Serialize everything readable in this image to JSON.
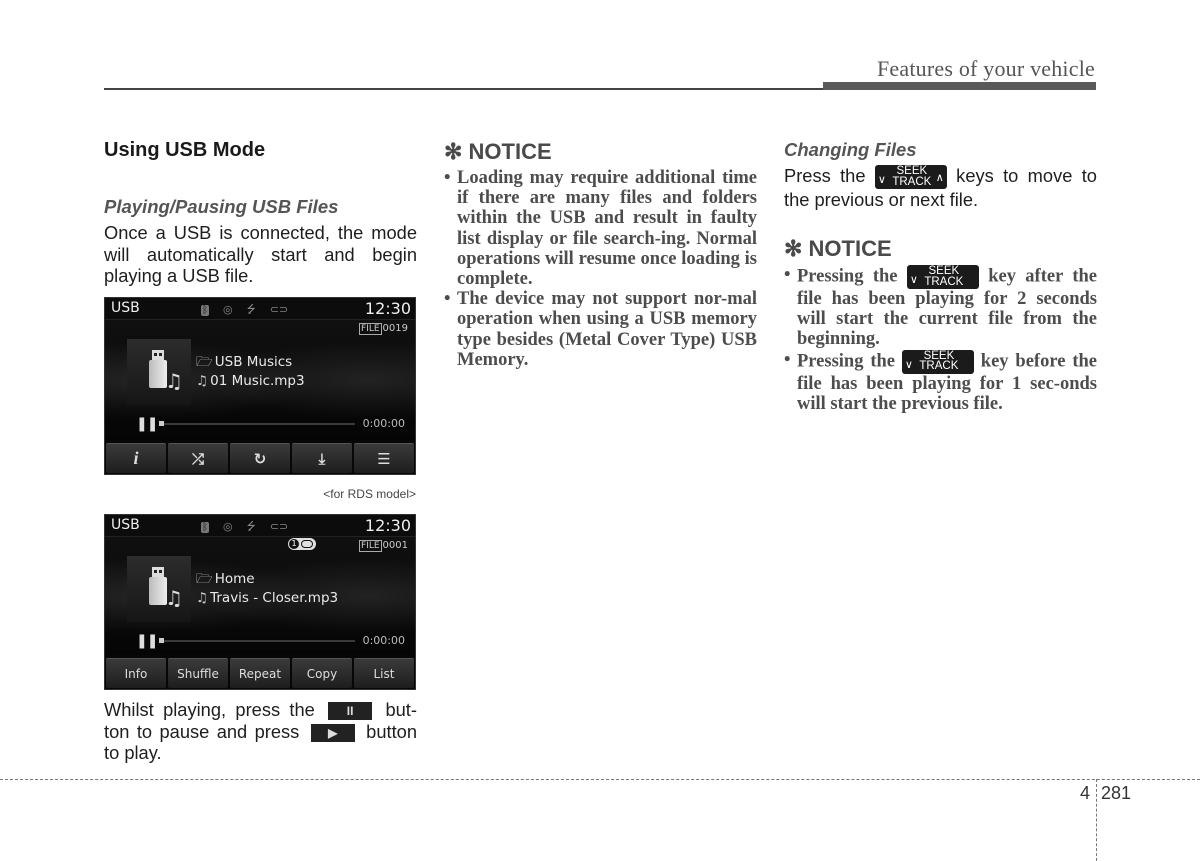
{
  "header": {
    "section_title": "Features of your vehicle"
  },
  "column1": {
    "title": "Using USB Mode",
    "subhead": "Playing/Pausing USB Files",
    "intro": "Once a USB is connected, the mode will automatically start and begin playing a USB file.",
    "caption": "<for RDS model>",
    "play_text": {
      "part1": "Whilst playing, press the",
      "part2": "but-ton to pause and press",
      "part3": "button to play.",
      "pause_glyph": "II",
      "play_glyph": "▶"
    }
  },
  "screen1": {
    "mode": "USB",
    "clock": "12:30",
    "status_icons": [
      "bluetooth-icon",
      "disc-icon",
      "usb-icon",
      "aux-icon"
    ],
    "file_tag": "FILE",
    "file_number": "0019",
    "folder": "USB Musics",
    "track": "01 Music.mp3",
    "elapsed": "0:00:00",
    "progress": 0,
    "softkeys": [
      {
        "icon": "info-icon",
        "glyph": "i"
      },
      {
        "icon": "shuffle-icon",
        "glyph": "⤮"
      },
      {
        "icon": "repeat-icon",
        "glyph": "↻"
      },
      {
        "icon": "copy-icon",
        "glyph": "⤓"
      },
      {
        "icon": "list-icon",
        "glyph": "☰"
      }
    ]
  },
  "screen2": {
    "mode": "USB",
    "clock": "12:30",
    "repeat_badge": "1",
    "file_tag": "FILE",
    "file_number": "0001",
    "folder": "Home",
    "track": "Travis - Closer.mp3",
    "elapsed": "0:00:00",
    "progress": 0,
    "softkeys": [
      "Info",
      "Shuffle",
      "Repeat",
      "Copy",
      "List"
    ]
  },
  "column2": {
    "notice_title": "✻ NOTICE",
    "items": [
      "Loading may require additional time if there are many files and folders within the USB and result in faulty list display or file search-ing. Normal operations will resume once loading is complete.",
      "The device may not support nor-mal operation when using a USB memory type besides (Metal Cover Type) USB Memory."
    ]
  },
  "column3": {
    "subhead": "Changing Files",
    "change_text": {
      "before": "Press the",
      "after": "keys to move to the previous or next file."
    },
    "seek_key": {
      "top": "SEEK",
      "bottom": "TRACK",
      "down": "∨",
      "up": "∧"
    },
    "notice_title": "✻ NOTICE",
    "items": [
      {
        "before": "Pressing the",
        "after": "key after the file has been playing for 2 seconds will start the current file from the beginning."
      },
      {
        "before": "Pressing the",
        "after": "key before the file has been playing for 1 sec-onds will start the previous file."
      }
    ]
  },
  "footer": {
    "chapter": "4",
    "page": "281"
  }
}
